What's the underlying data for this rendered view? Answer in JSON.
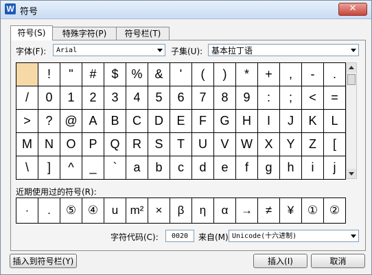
{
  "window": {
    "title": "符号",
    "close_label": "✕",
    "app_icon": "W"
  },
  "tabs": [
    {
      "label": "符号(S)",
      "active": true
    },
    {
      "label": "特殊字符(P)",
      "active": false
    },
    {
      "label": "符号栏(T)",
      "active": false
    }
  ],
  "font": {
    "label": "字体(F):",
    "value": "Arial"
  },
  "subset": {
    "label": "子集(U):",
    "value": "基本拉丁语"
  },
  "symbols": [
    " ",
    "!",
    "\"",
    "#",
    "$",
    "%",
    "&",
    "'",
    "(",
    ")",
    "*",
    "+",
    ",",
    "-",
    ".",
    "/",
    "0",
    "1",
    "2",
    "3",
    "4",
    "5",
    "6",
    "7",
    "8",
    "9",
    ":",
    ";",
    "<",
    "=",
    ">",
    "?",
    "@",
    "A",
    "B",
    "C",
    "D",
    "E",
    "F",
    "G",
    "H",
    "I",
    "J",
    "K",
    "L",
    "M",
    "N",
    "O",
    "P",
    "Q",
    "R",
    "S",
    "T",
    "U",
    "V",
    "W",
    "X",
    "Y",
    "Z",
    "[",
    "\\",
    "]",
    "^",
    "_",
    "`",
    "a",
    "b",
    "c",
    "d",
    "e",
    "f",
    "g",
    "h",
    "i",
    "j"
  ],
  "recent": {
    "label": "近期使用过的符号(R):",
    "symbols": [
      "·",
      ".",
      "⑤",
      "④",
      "u",
      "m²",
      "×",
      "β",
      "η",
      "α",
      "→",
      "≠",
      "¥",
      "①",
      "②"
    ]
  },
  "code": {
    "label": "字符代码(C):",
    "value": "0020",
    "from_label": "来自(M)",
    "from_value": "Unicode(十六进制)"
  },
  "buttons": {
    "insert_to_bar": "插入到符号栏(Y)",
    "insert": "插入(I)",
    "cancel": "取消"
  }
}
